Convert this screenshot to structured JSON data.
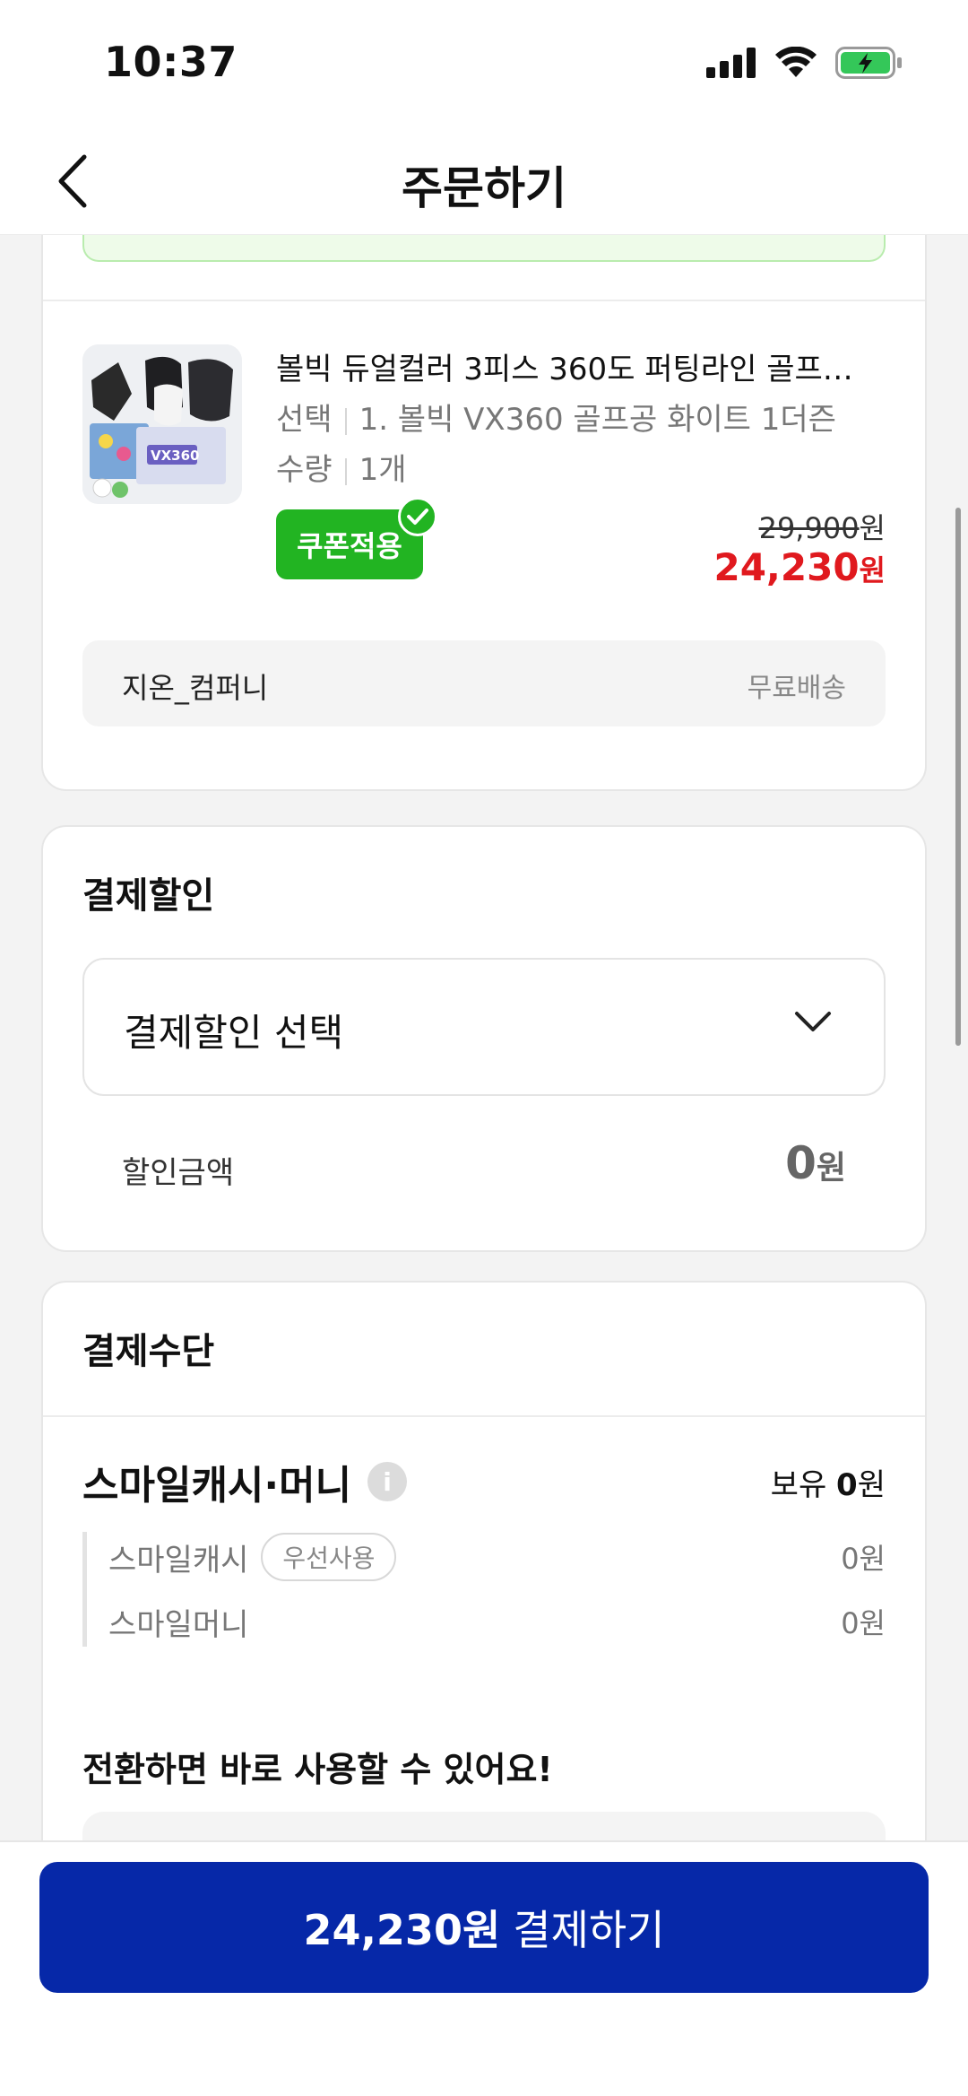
{
  "status_bar": {
    "time": "10:37"
  },
  "header": {
    "title": "주문하기"
  },
  "product": {
    "name": "볼빅 듀얼컬러 3피스 360도 퍼팅라인 골프…",
    "option_label": "선택",
    "option_value": "1. 볼빅 VX360 골프공 화이트 1더즌",
    "quantity_label": "수량",
    "quantity_value": "1개",
    "coupon_badge": "쿠폰적용",
    "original_price": "29,900",
    "original_price_unit": "원",
    "sale_price": "24,230",
    "sale_price_unit": "원",
    "seller": "지온_컴퍼니",
    "shipping": "무료배송"
  },
  "payment_discount": {
    "title": "결제할인",
    "select_label": "결제할인 선택",
    "discount_label": "할인금액",
    "discount_amount": "0",
    "discount_unit": "원"
  },
  "payment_method": {
    "title": "결제수단",
    "smile_title": "스마일캐시·머니",
    "info_glyph": "i",
    "balance_label": "보유",
    "balance_amount": "0",
    "balance_unit": "원",
    "smile_cash_label": "스마일캐시",
    "priority_label": "우선사용",
    "smile_cash_value": "0원",
    "smile_money_label": "스마일머니",
    "smile_money_value": "0원",
    "switch_text": "전환하면 바로 사용할 수 있어요!"
  },
  "bottom": {
    "pay_amount": "24,230원",
    "pay_label": "결제하기"
  },
  "colors": {
    "primary": "#0628a8",
    "coupon_green": "#22b422",
    "sale_red": "#e0191e"
  }
}
